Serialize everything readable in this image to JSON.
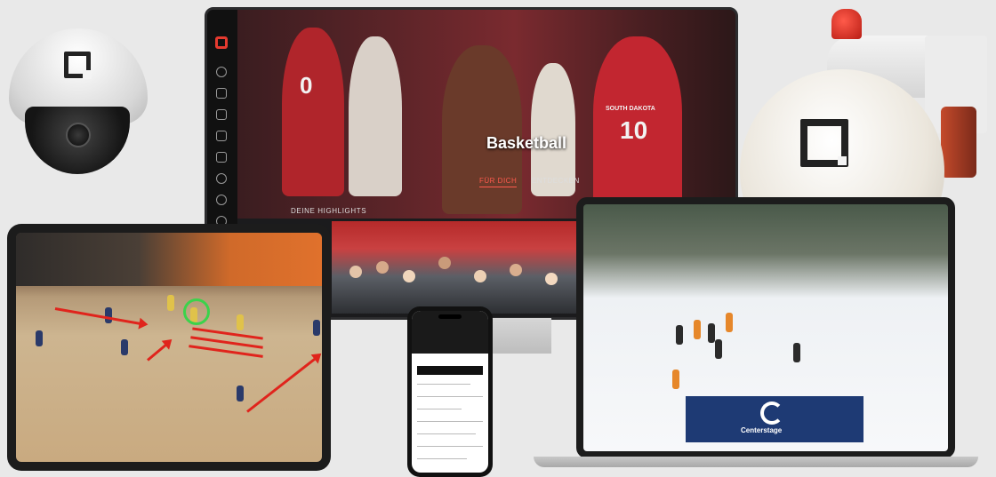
{
  "monitor": {
    "hero_title": "Basketball",
    "tabs": {
      "active": "FÜR DICH",
      "inactive": "ENTDECKEN"
    },
    "section_label": "DEINE HIGHLIGHTS",
    "jersey_numbers": [
      "0",
      "10"
    ],
    "jersey_text": "SOUTH DAKOTA"
  },
  "laptop": {
    "brand_text": "Centerstage"
  },
  "colors": {
    "accent": "#e53a2f",
    "highlight_green": "#3bd34b",
    "brand_blue": "#1e3a74"
  }
}
